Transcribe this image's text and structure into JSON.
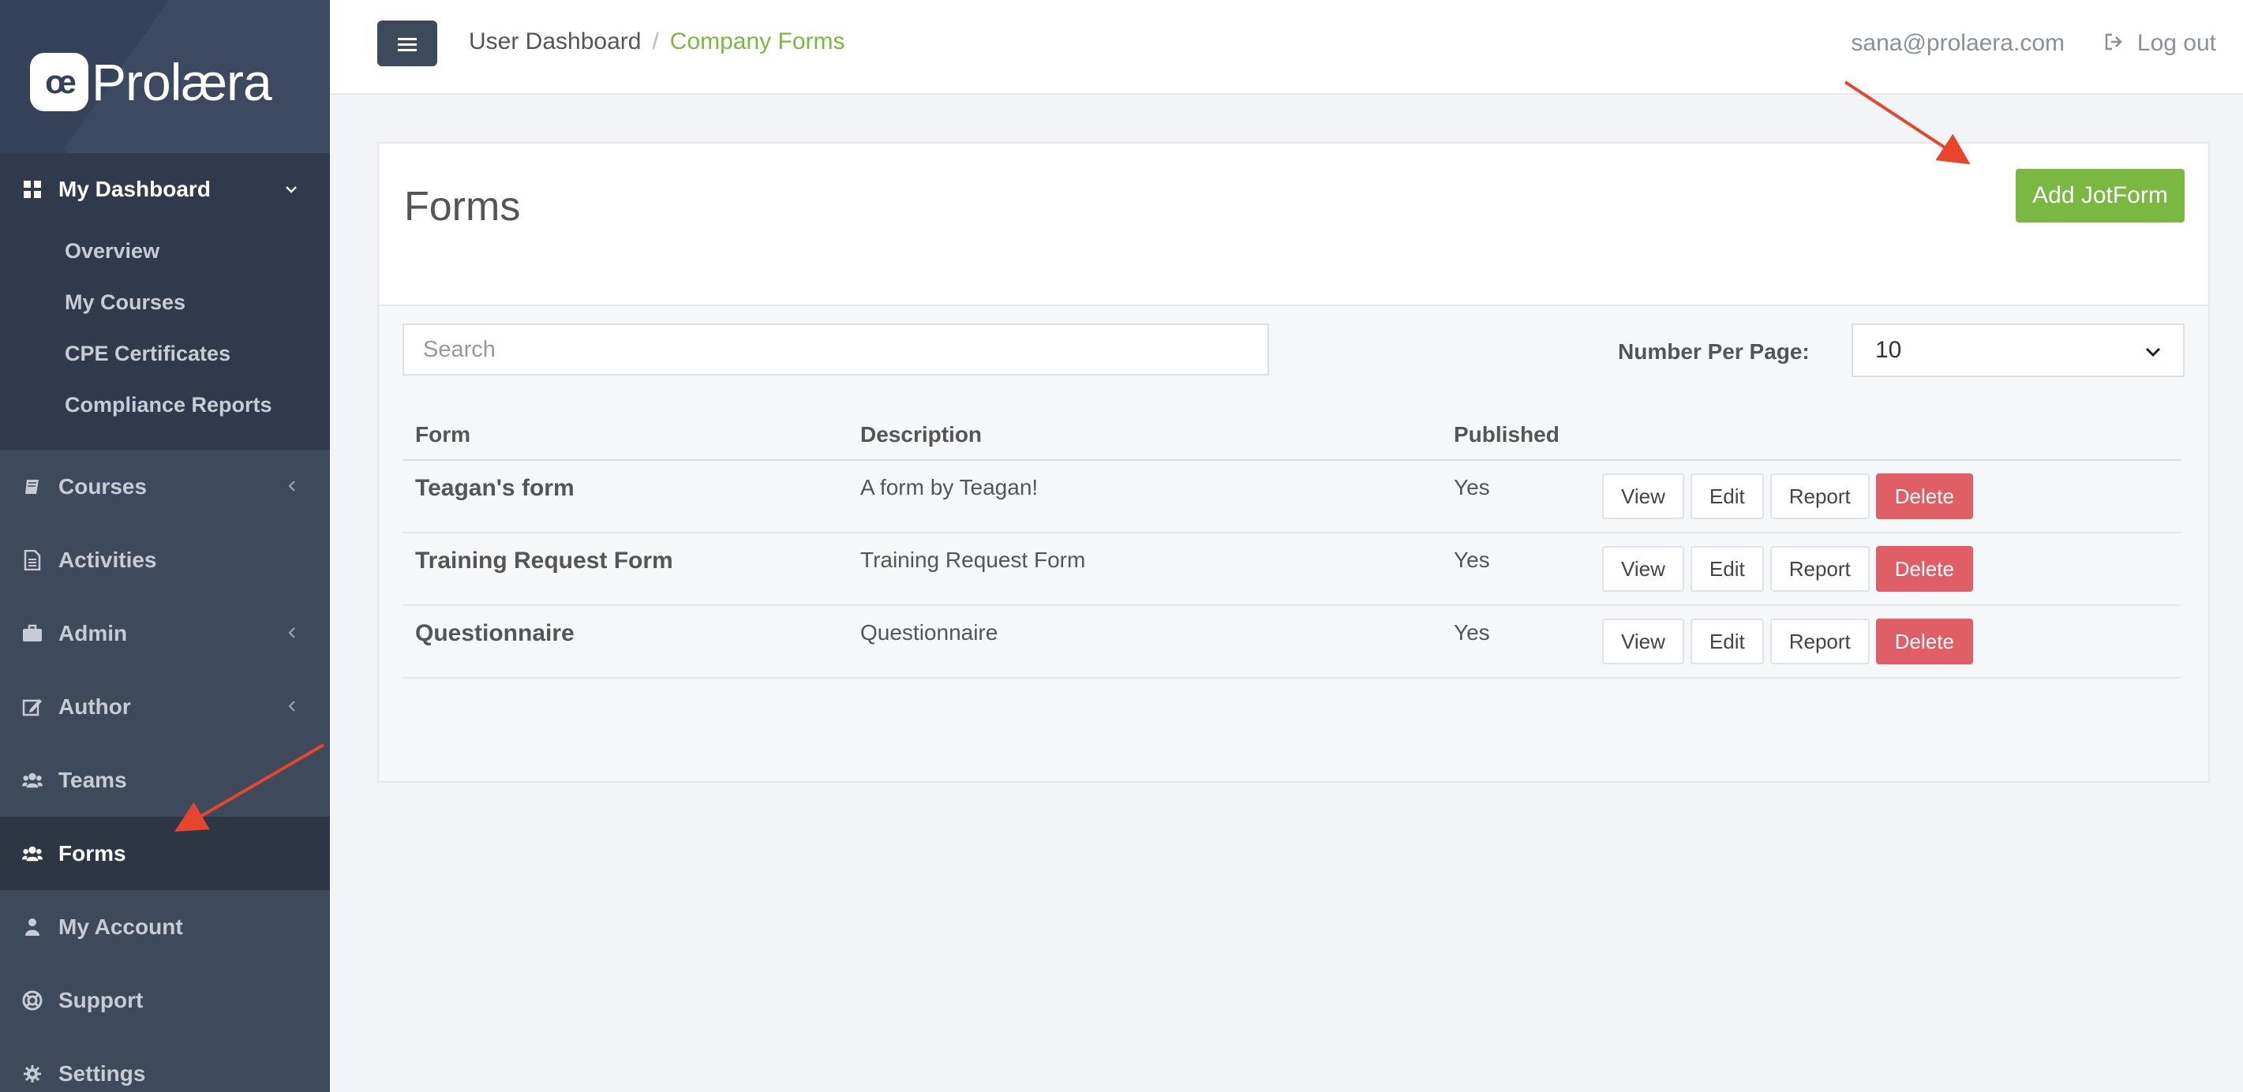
{
  "brand": {
    "logo_mark": "œ",
    "logo_text": "Prolæra"
  },
  "sidebar": {
    "dashboard": {
      "label": "My Dashboard",
      "icon": "dashboard-icon"
    },
    "sub_items": [
      "Overview",
      "My Courses",
      "CPE Certificates",
      "Compliance Reports"
    ],
    "items": [
      {
        "label": "Courses",
        "icon": "book-icon",
        "has_caret": true
      },
      {
        "label": "Activities",
        "icon": "document-icon",
        "has_caret": false
      },
      {
        "label": "Admin",
        "icon": "briefcase-icon",
        "has_caret": true
      },
      {
        "label": "Author",
        "icon": "edit-icon",
        "has_caret": true
      },
      {
        "label": "Teams",
        "icon": "users-icon",
        "has_caret": false
      },
      {
        "label": "Forms",
        "icon": "users-icon",
        "has_caret": false,
        "active": true
      },
      {
        "label": "My Account",
        "icon": "user-icon",
        "has_caret": false
      },
      {
        "label": "Support",
        "icon": "lifebuoy-icon",
        "has_caret": false
      },
      {
        "label": "Settings",
        "icon": "gear-icon",
        "has_caret": false
      }
    ]
  },
  "topbar": {
    "breadcrumb": {
      "parent": "User Dashboard",
      "separator": "/",
      "current": "Company Forms"
    },
    "user_email": "sana@prolaera.com",
    "logout_label": "Log out"
  },
  "panel": {
    "title": "Forms",
    "add_button": "Add JotForm",
    "search_placeholder": "Search",
    "number_per_page_label": "Number Per Page:",
    "number_per_page_value": "10"
  },
  "table": {
    "columns": [
      "Form",
      "Description",
      "Published"
    ],
    "rows": [
      {
        "form": "Teagan's form",
        "description": "A form by Teagan!",
        "published": "Yes"
      },
      {
        "form": "Training Request Form",
        "description": "Training Request Form",
        "published": "Yes"
      },
      {
        "form": "Questionnaire",
        "description": "Questionnaire",
        "published": "Yes"
      }
    ],
    "actions": {
      "view": "View",
      "edit": "Edit",
      "report": "Report",
      "delete": "Delete"
    }
  },
  "colors": {
    "accent_green": "#7ab842",
    "danger_red": "#e05e66",
    "sidebar": "#3d4a5c",
    "annotation_arrow": "#e8452c"
  }
}
